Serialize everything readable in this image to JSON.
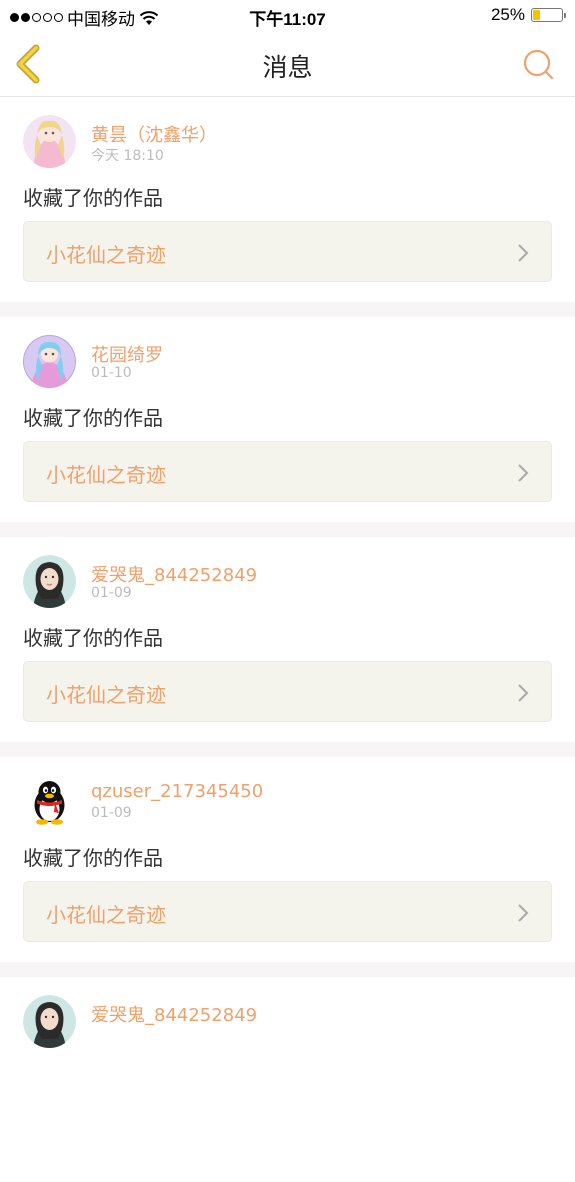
{
  "status_bar": {
    "carrier": "中国移动",
    "time": "下午11:07",
    "battery_percent": "25%",
    "battery_level": 0.25,
    "signal_filled": 2,
    "signal_total": 5,
    "battery_color": "#f5c400"
  },
  "nav": {
    "title": "消息",
    "back_icon": "chevron-left-icon",
    "search_icon": "search-icon",
    "accent": "#f0a06a"
  },
  "messages": [
    {
      "username": "黄昙（沈鑫华）",
      "time": "今天 18:10",
      "text": "收藏了你的作品",
      "work_title": "小花仙之奇迹",
      "avatar": "anime-girl-pink-avatar"
    },
    {
      "username": "花园绮罗",
      "time": "01-10",
      "text": "收藏了你的作品",
      "work_title": "小花仙之奇迹",
      "avatar": "anime-girl-purple-avatar"
    },
    {
      "username": "爱哭鬼_844252849",
      "time": "01-09",
      "text": "收藏了你的作品",
      "work_title": "小花仙之奇迹",
      "avatar": "woman-portrait-avatar"
    },
    {
      "username": "qzuser_217345450",
      "time": "01-09",
      "text": "收藏了你的作品",
      "work_title": "小花仙之奇迹",
      "avatar": "qq-penguin-avatar"
    },
    {
      "username": "爱哭鬼_844252849",
      "time": "",
      "text": "",
      "work_title": "",
      "avatar": "woman-portrait-avatar"
    }
  ]
}
